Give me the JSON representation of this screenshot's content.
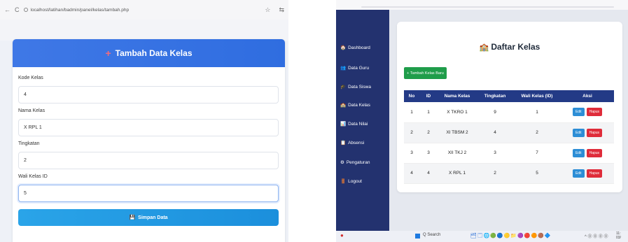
{
  "browser": {
    "url": "localhost/latihan/badmin/panel/kelas/tambah.php",
    "back_icon": "←",
    "reload_icon": "C",
    "star_icon": "☆",
    "ext_icon": "⇆"
  },
  "form": {
    "header_icon": "+",
    "title": "Tambah Data Kelas",
    "fields": [
      {
        "label": "Kode Kelas",
        "value": "4"
      },
      {
        "label": "Nama Kelas",
        "value": "X RPL 1"
      },
      {
        "label": "Tingkatan",
        "value": "2"
      },
      {
        "label": "Wali Kelas ID",
        "value": "5"
      }
    ],
    "submit_icon": "💾",
    "submit_label": "Simpan Data"
  },
  "sidebar": {
    "items": [
      {
        "icon": "🏠",
        "label": "Dashboard"
      },
      {
        "icon": "👥",
        "label": "Data Guru"
      },
      {
        "icon": "🎓",
        "label": "Data Siswa"
      },
      {
        "icon": "🏫",
        "label": "Data Kelas"
      },
      {
        "icon": "📊",
        "label": "Data Nilai"
      },
      {
        "icon": "📋",
        "label": "Absensi"
      },
      {
        "icon": "⚙",
        "label": "Pengaturan"
      },
      {
        "icon": "🚪",
        "label": "Logout"
      }
    ]
  },
  "daftar": {
    "title_icon": "🏫",
    "title": "Daftar Kelas",
    "add_button": "+ Tambah Kelas Baru",
    "columns": [
      "No",
      "ID",
      "Nama Kelas",
      "Tingkatan",
      "Wali Kelas (ID)",
      "Aksi"
    ],
    "rows": [
      {
        "no": "1",
        "id": "1",
        "nama": "X TKRO 1",
        "tingkatan": "9",
        "wali": "1"
      },
      {
        "no": "2",
        "id": "2",
        "nama": "XI TBSM 2",
        "tingkatan": "4",
        "wali": "2"
      },
      {
        "no": "3",
        "id": "3",
        "nama": "XII TKJ 2",
        "tingkatan": "3",
        "wali": "7"
      },
      {
        "no": "4",
        "id": "4",
        "nama": "X RPL 1",
        "tingkatan": "2",
        "wali": "5"
      }
    ],
    "edit_label": "Edit",
    "hapus_label": "Hapus"
  },
  "taskbar": {
    "start_icon": "●",
    "search_label": "Q Search",
    "apps": "🗂🗔🌐🟢🔵🟡📁🟣🔴🟠🟤🔷",
    "tray": "^ ⓪ ⓪ ⓪ ⓪",
    "time": "11:",
    "date": "03/"
  }
}
